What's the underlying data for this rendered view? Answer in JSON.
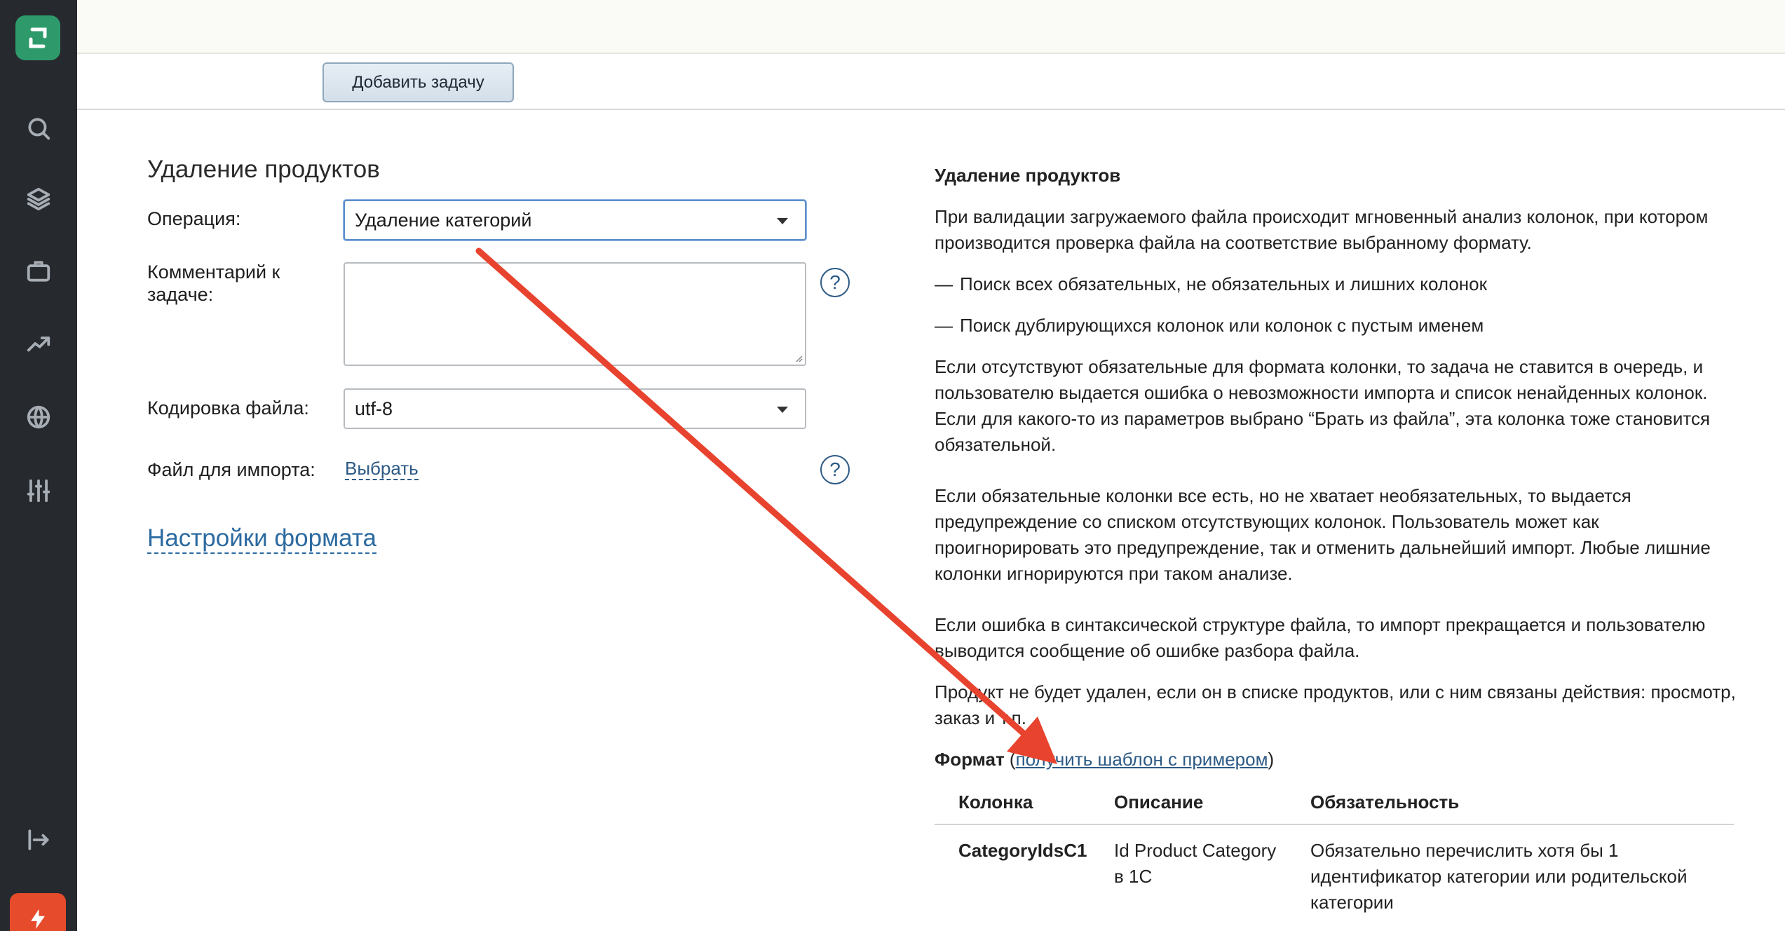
{
  "toolbar": {
    "add_task_label": "Добавить задачу"
  },
  "form": {
    "title": "Удаление продуктов",
    "operation_label": "Операция:",
    "operation_value": "Удаление категорий",
    "comment_label": "Комментарий к задаче:",
    "comment_value": "",
    "encoding_label": "Кодировка файла:",
    "encoding_value": "utf-8",
    "file_label": "Файл для импорта:",
    "file_choose": "Выбрать",
    "help_glyph": "?",
    "format_settings": "Настройки формата"
  },
  "help": {
    "title": "Удаление продуктов",
    "intro": "При валидации загружаемого файла происходит мгновенный анализ колонок, при котором производится проверка файла на соответствие выбранному формату.",
    "bullets": [
      "Поиск всех обязательных, не обязательных и лишних колонок",
      "Поиск дублирующихся колонок или колонок с пустым именем"
    ],
    "p1": "Если отсутствуют обязательные для формата колонки, то задача не ставится в очередь, и пользователю выдается ошибка о невозможности импорта и список ненайденных колонок. Если для какого-то из параметров выбрано “Брать из файла”, эта колонка тоже становится обязательной.",
    "p2": "Если обязательные колонки все есть, но не хватает необязательных, то выдается предупреждение со списком отсутствующих колонок. Пользователь может как проигнорировать это предупреждение, так и отменить дальнейший импорт. Любые лишние колонки игнорируются при таком анализе.",
    "p3": "Если ошибка в синтаксической структуре файла, то импорт прекращается и пользователю выводится сообщение об ошибке разбора файла.",
    "p4": "Продукт не будет удален, если он в списке продуктов, или с ним связаны действия: просмотр, заказ и т.п.",
    "format_label": "Формат",
    "template_link": "получить шаблон с примером",
    "table": {
      "headers": [
        "Колонка",
        "Описание",
        "Обязательность"
      ],
      "rows": [
        {
          "column": "CategoryIdsC1",
          "description": "Id Product Category в 1С",
          "required": "Обязательно перечислить хотя бы 1 идентификатор категории или родительской категории"
        }
      ]
    }
  },
  "colors": {
    "sidebar": "#26292e",
    "brand": "#2e9a6b",
    "accent": "#e64b2c",
    "link": "#2c5a85",
    "annotation_arrow": "#e8432e"
  },
  "icons": [
    "logo-icon",
    "search-icon",
    "layers-icon",
    "briefcase-icon",
    "trending-icon",
    "globe-icon",
    "sliders-icon",
    "logout-icon",
    "bolt-icon",
    "help-icon",
    "caret-down-icon"
  ]
}
